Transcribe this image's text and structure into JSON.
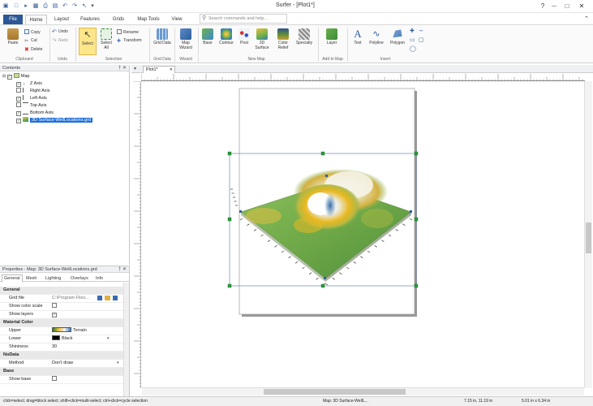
{
  "app": {
    "title": "Surfer - [Plot1*]",
    "min": "—",
    "max": "□",
    "close": "✕",
    "file_tab": "File",
    "tabs": [
      "Home",
      "Layout",
      "Features",
      "Grids",
      "Map Tools",
      "View"
    ],
    "search_placeholder": "Search commands and help..."
  },
  "ribbon": {
    "groups": {
      "clipboard": "Clipboard",
      "undo": "Undo",
      "selection": "Selection",
      "grid_data": "Grid Data",
      "wizard": "Wizard",
      "new_map": "New Map",
      "add_to_map": "Add to Map",
      "insert": "Insert"
    },
    "paste": "Paste",
    "copy": "Copy",
    "cut": "Cut",
    "delete": "Delete",
    "undo": "Undo",
    "redo": "Redo",
    "select": "Select",
    "select_all": "Select All",
    "rename": "Rename",
    "transform": "Transform",
    "grid_data": "Grid Data",
    "map_wizard": "Map Wizard",
    "base": "Base",
    "contour": "Contour",
    "post": "Post",
    "surface3d": "3D Surface",
    "color_relief": "Color Relief",
    "specialty": "Specialty",
    "layer": "Layer",
    "text": "Text",
    "polyline": "Polyline",
    "polygon": "Polygon"
  },
  "contents": {
    "title": "Contents",
    "controls": "† ✕",
    "items": [
      {
        "label": "Map"
      },
      {
        "label": "Z Axis"
      },
      {
        "label": "Right Axis"
      },
      {
        "label": "Left Axis"
      },
      {
        "label": "Top Axis"
      },
      {
        "label": "Bottom Axis"
      },
      {
        "label": "3D Surface-WellLocations.grd"
      }
    ]
  },
  "properties": {
    "title": "Properties - Map: 3D Surface-WellLocations.grd",
    "controls": "† ✕",
    "tabs": [
      "General",
      "Mesh",
      "Lighting",
      "Overlays",
      "Info"
    ],
    "rows": {
      "general": "General",
      "grid_file": "Grid file",
      "grid_file_value": "C:\\Program Files...",
      "show_color_scale": "Show color scale",
      "show_layers": "Show layers",
      "material_color": "Material Color",
      "upper": "Upper",
      "upper_value": "Terrain",
      "lower": "Lower",
      "lower_value": "Black",
      "shininess": "Shininess",
      "shininess_value": "30",
      "nodata": "NoData",
      "method": "Method",
      "method_value": "Don't draw",
      "base": "Base",
      "show_base": "Show base"
    }
  },
  "document": {
    "tab": "Plot1*"
  },
  "status": {
    "hint": "click=select; drag=block select; shift+click=multi-select; ctrl+click=cycle selection",
    "selection": "Map: 3D Surface-WellL...",
    "position": "7.15 in, 11.19 in",
    "size": "5.01 in x 6.34 in"
  },
  "colors": {
    "file_tab": "#2b5797",
    "selection": "#1e6fd9",
    "surface_green": "#7fb24a",
    "surface_yellow": "#e8b820",
    "surface_white": "#f4f4f0",
    "surface_blue": "#1e5e9a",
    "handle": "#2a9a3a"
  }
}
